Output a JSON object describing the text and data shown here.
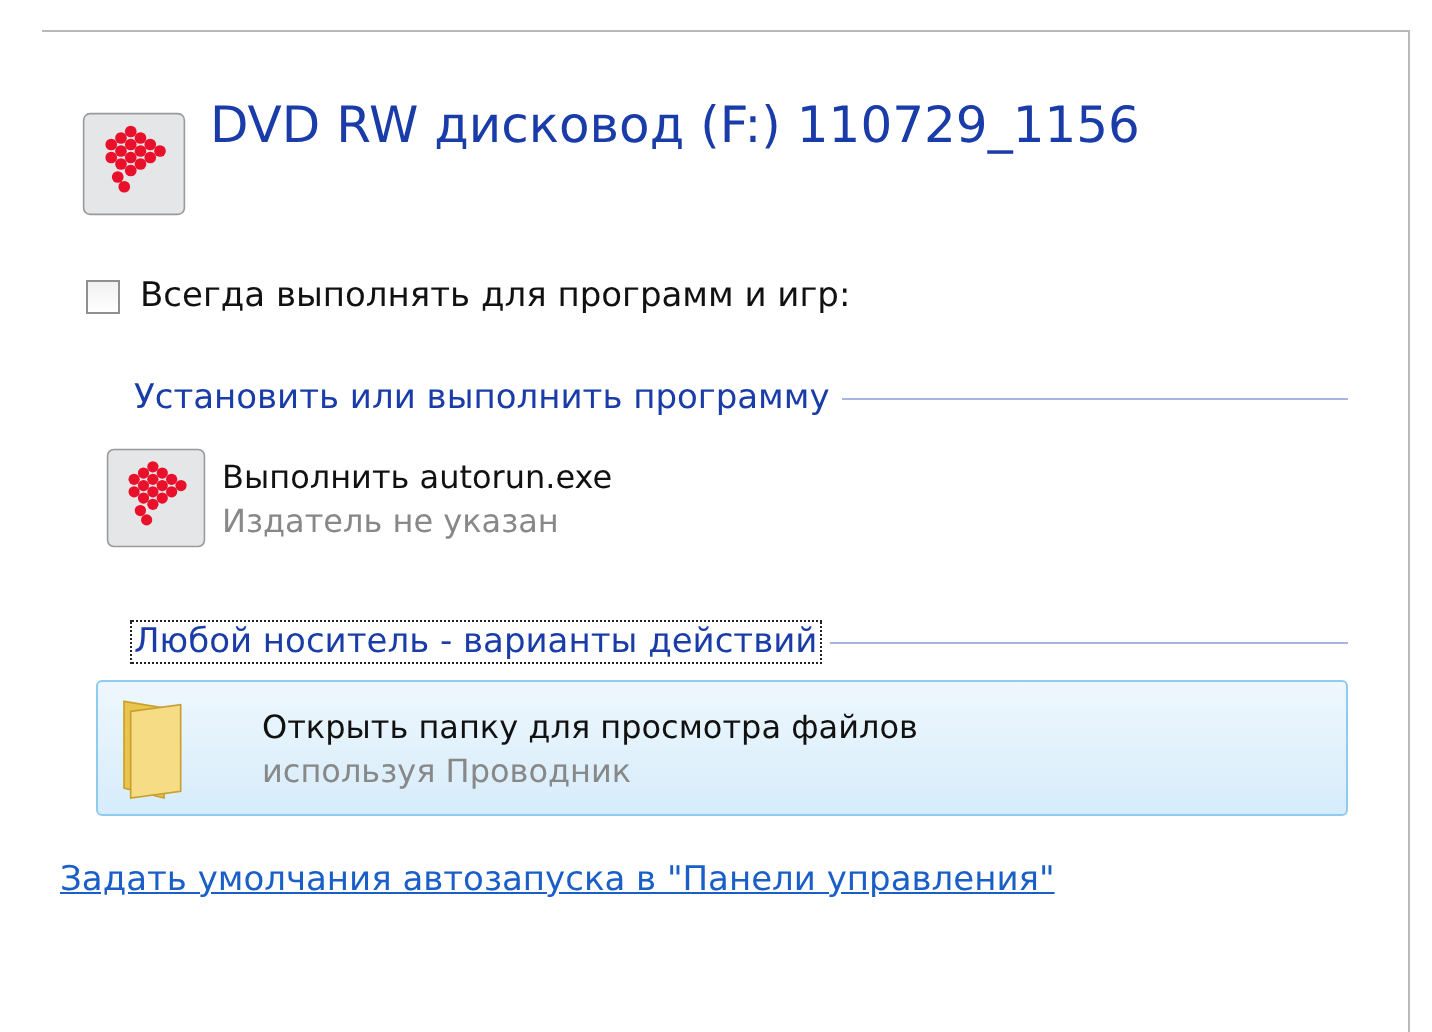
{
  "header": {
    "title": "DVD RW дисковод (F:) 110729_1156"
  },
  "always_checkbox": {
    "label": "Всегда выполнять для программ и игр:",
    "checked": false
  },
  "groups": [
    {
      "heading": "Установить или выполнить программу",
      "focused": false,
      "items": [
        {
          "kind": "program",
          "title": "Выполнить autorun.exe",
          "subtitle": "Издатель не указан",
          "selected": false
        }
      ]
    },
    {
      "heading": "Любой носитель - варианты действий",
      "focused": true,
      "items": [
        {
          "kind": "folder",
          "title": "Открыть папку для просмотра файлов",
          "subtitle": "используя Проводник",
          "selected": true
        }
      ]
    }
  ],
  "footer_link": "Задать умолчания автозапуска в \"Панели управления\""
}
